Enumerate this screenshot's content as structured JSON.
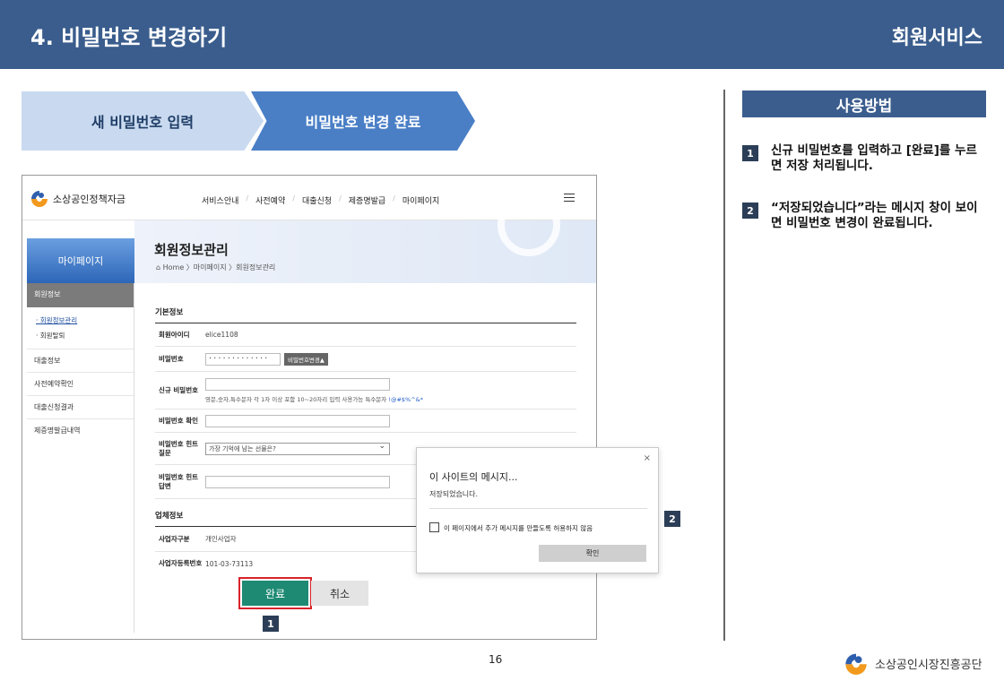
{
  "header": {
    "title": "4. 비밀번호 변경하기",
    "section": "회원서비스"
  },
  "steps": [
    {
      "label": "새 비밀번호 입력"
    },
    {
      "label": "비밀번호 변경 완료"
    }
  ],
  "screenshot": {
    "logo_text": "소상공인정책자금",
    "menu": [
      "서비스안내",
      "사전예약",
      "대출신청",
      "제증명발급",
      "마이페이지"
    ],
    "lnb_title": "마이페이지",
    "banner_title": "회원정보관리",
    "breadcrumb": "Home 〉마이페이지 〉회원정보관리",
    "lnb": {
      "group": "회원정보",
      "subs": [
        "· 회원정보관리",
        "· 회원탈퇴"
      ],
      "items": [
        "대출정보",
        "사전예약확인",
        "대출신청결과",
        "제증명발급내역"
      ]
    },
    "basic_section": "기본정보",
    "fields": {
      "member_id_label": "회원아이디",
      "member_id_value": "elice1108",
      "password_label": "비밀번호",
      "password_mask": "·············",
      "password_btn": "비밀번호변경▲",
      "new_pw_label": "신규 비밀번호",
      "new_pw_help": "영문,숫자,특수문자 각 1자 이상 포함 10~20자리 입력 사용가능 특수문자",
      "new_pw_special": "!@#$%^&*",
      "confirm_label": "비밀번호 확인",
      "hint_q_label": "비밀번호 힌트 질문",
      "hint_q_value": "가장 기억에 남는 선물은?",
      "hint_a_label": "비밀번호 힌트 답변"
    },
    "company_section": "업체정보",
    "company": {
      "type_label": "사업자구분",
      "type_value": "개인사업자",
      "regno_label": "사업자등록번호",
      "regno_value": "101-03-73113"
    },
    "btn_ok": "완료",
    "btn_cancel": "취소",
    "marker1": "1",
    "marker2": "2"
  },
  "dialog": {
    "close": "×",
    "title": "이 사이트의 메시지...",
    "message": "저장되었습니다.",
    "checkbox_label": "이 페이지에서 추가 메시지를 만들도록 허용하지 않음",
    "confirm": "확인"
  },
  "howto": {
    "title": "사용방법",
    "items": [
      {
        "num": "1",
        "text": "신규 비밀번호를 입력하고 [완료]를 누르면 저장 처리됩니다."
      },
      {
        "num": "2",
        "text": "“저장되었습니다”라는 메시지 창이 보이면 비밀번호 변경이 완료됩니다."
      }
    ]
  },
  "footer": {
    "page": "16",
    "org": "소상공인시장진흥공단"
  }
}
